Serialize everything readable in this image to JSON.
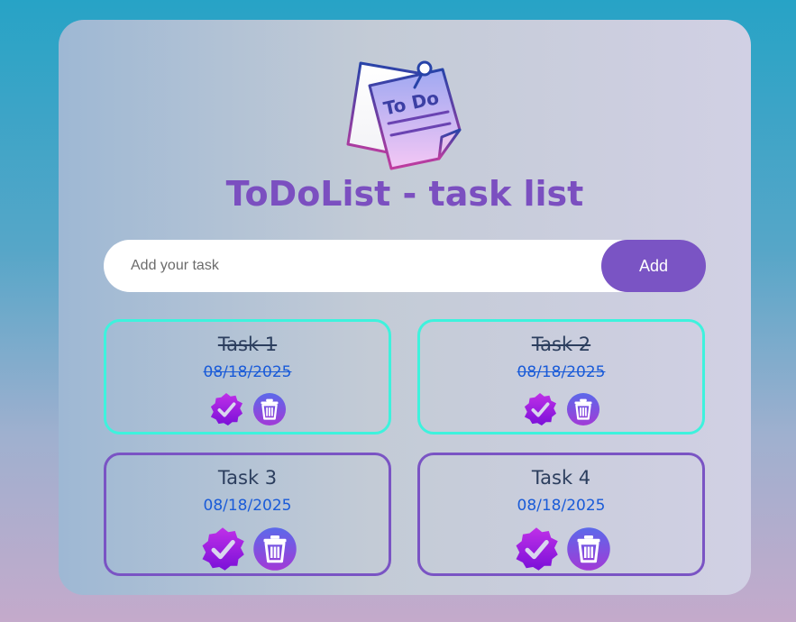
{
  "app": {
    "title": "ToDoList - task list"
  },
  "logo": {
    "icon": "todo-note-icon",
    "text": "To Do"
  },
  "input": {
    "placeholder": "Add your task",
    "value": ""
  },
  "buttons": {
    "add_label": "Add"
  },
  "tasks": [
    {
      "name": "Task 1",
      "date": "08/18/2025",
      "completed": true
    },
    {
      "name": "Task 2",
      "date": "08/18/2025",
      "completed": true
    },
    {
      "name": "Task 3",
      "date": "08/18/2025",
      "completed": false
    },
    {
      "name": "Task 4",
      "date": "08/18/2025",
      "completed": false
    }
  ],
  "colors": {
    "accent": "#7a54c4",
    "completed_border": "#3ef2dd",
    "date_text": "#1a5bd8",
    "title_text": "#7b4fc0"
  },
  "icons": {
    "complete": "check-badge-icon",
    "delete": "trash-icon"
  }
}
